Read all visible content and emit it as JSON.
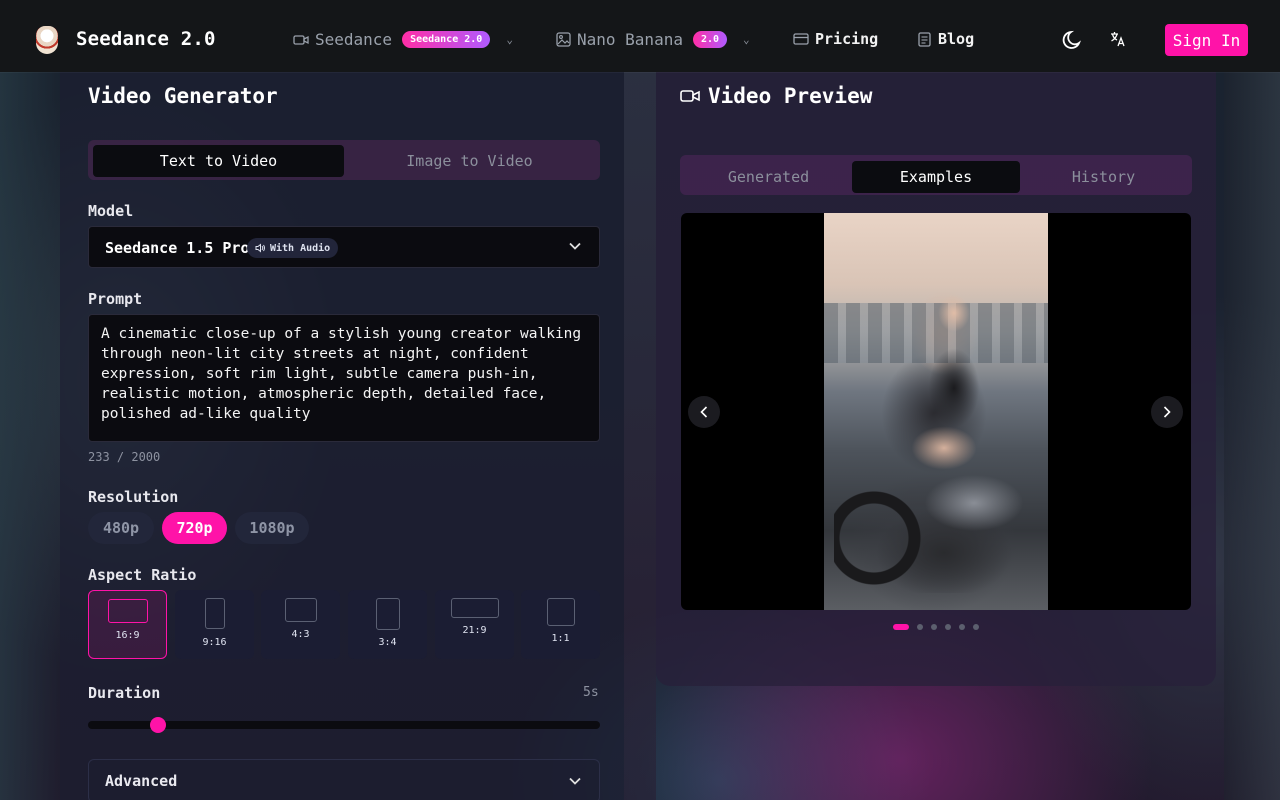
{
  "header": {
    "brand": "Seedance 2.0",
    "nav": [
      {
        "label": "Seedance",
        "badge": "Seedance 2.0",
        "icon": "video-icon"
      },
      {
        "label": "Nano Banana",
        "badge": "2.0",
        "icon": "image-icon"
      },
      {
        "label": "Pricing",
        "icon": "card-icon"
      },
      {
        "label": "Blog",
        "icon": "document-icon"
      }
    ],
    "sign_in": "Sign In"
  },
  "generator": {
    "title": "Video Generator",
    "modes": [
      "Text to Video",
      "Image to Video"
    ],
    "active_mode": "Text to Video",
    "model_label": "Model",
    "model_value": "Seedance 1.5 Pro",
    "model_badge": "With Audio",
    "prompt_label": "Prompt",
    "prompt_value": "A cinematic close-up of a stylish young creator walking\nthrough neon-lit city streets at night, confident\nexpression, soft rim light, subtle camera push-in,\nrealistic motion, atmospheric depth, detailed face,\npolished ad-like quality",
    "prompt_counter": "233 / 2000",
    "resolution_label": "Resolution",
    "resolutions": [
      "480p",
      "720p",
      "1080p"
    ],
    "selected_resolution": "720p",
    "aspect_label": "Aspect Ratio",
    "aspects": [
      "16:9",
      "9:16",
      "4:3",
      "3:4",
      "21:9",
      "1:1"
    ],
    "selected_aspect": "16:9",
    "duration_label": "Duration",
    "duration_value": "5s",
    "advanced_label": "Advanced"
  },
  "preview": {
    "title": "Video Preview",
    "tabs": [
      "Generated",
      "Examples",
      "History"
    ],
    "active_tab": "Examples",
    "slide_count": 6,
    "active_slide": 1
  },
  "colors": {
    "accent": "#ff13a8",
    "header_bg": "#141618"
  }
}
